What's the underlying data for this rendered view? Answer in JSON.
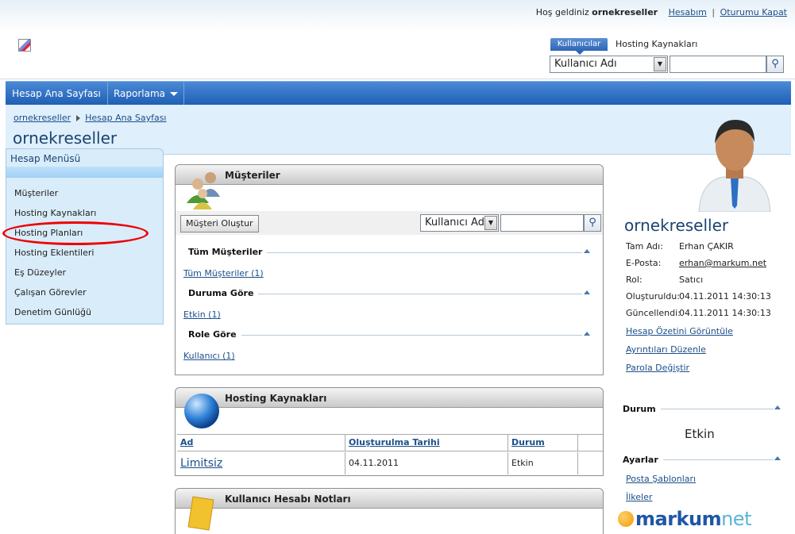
{
  "header": {
    "welcome_text": "Hoş geldiniz",
    "username": "ornekreseller",
    "account_link": "Hesabım",
    "separator": "|",
    "logout_link": "Oturumu Kapat"
  },
  "search": {
    "tab_active": "Kullanıcılar",
    "tab_other": "Hosting Kaynakları",
    "select_value": "Kullanıcı Adı",
    "input_value": ""
  },
  "nav": {
    "items": [
      {
        "label": "Hesap Ana Sayfası"
      },
      {
        "label": "Raporlama"
      }
    ]
  },
  "breadcrumb": {
    "items": [
      "ornekreseller",
      "Hesap Ana Sayfası"
    ]
  },
  "page": {
    "title": "ornekreseller"
  },
  "left_menu": {
    "title": "Hesap Menüsü",
    "items": [
      "Müşteriler",
      "Hosting Kaynakları",
      "Hosting Planları",
      "Hosting Eklentileri",
      "Eş Düzeyler",
      "Çalışan Görevler",
      "Denetim Günlüğü"
    ]
  },
  "customers_panel": {
    "title": "Müşteriler",
    "create_button": "Müşteri Oluştur",
    "select_value": "Kullanıcı Adı",
    "groups": [
      {
        "heading": "Tüm Müşteriler",
        "link": "Tüm Müşteriler (1)"
      },
      {
        "heading": "Duruma Göre",
        "link": "Etkin (1)"
      },
      {
        "heading": "Role Göre",
        "link": "Kullanıcı (1)"
      }
    ]
  },
  "hosting_panel": {
    "title": "Hosting Kaynakları",
    "columns": [
      "Ad",
      "Oluşturulma Tarihi",
      "Durum"
    ],
    "rows": [
      {
        "name": "Limitsiz",
        "date": "04.11.2011",
        "status": "Etkin"
      }
    ]
  },
  "notes_panel": {
    "title": "Kullanıcı Hesabı Notları"
  },
  "profile": {
    "name": "ornekreseller",
    "fields": [
      {
        "label": "Tam Adı:",
        "value": "Erhan ÇAKIR"
      },
      {
        "label": "E-Posta:",
        "value": "erhan@markum.net"
      },
      {
        "label": "Rol:",
        "value": "Satıcı"
      },
      {
        "label": "Oluşturuldu:",
        "value": "04.11.2011 14:30:13"
      },
      {
        "label": "Güncellendi:",
        "value": "04.11.2011 14:30:13"
      }
    ],
    "links": [
      "Hesap Özetini Görüntüle",
      "Ayrıntıları Düzenle",
      "Parola Değiştir"
    ],
    "status_heading": "Durum",
    "status_value": "Etkin",
    "settings_heading": "Ayarlar",
    "settings_links": [
      "Posta Şablonları",
      "İlkeler"
    ]
  },
  "brand": {
    "part1": "markum",
    "part2": "net"
  },
  "colors": {
    "accent": "#2f6fc0",
    "highlight": "#e00000",
    "link": "#1b4f8a"
  }
}
